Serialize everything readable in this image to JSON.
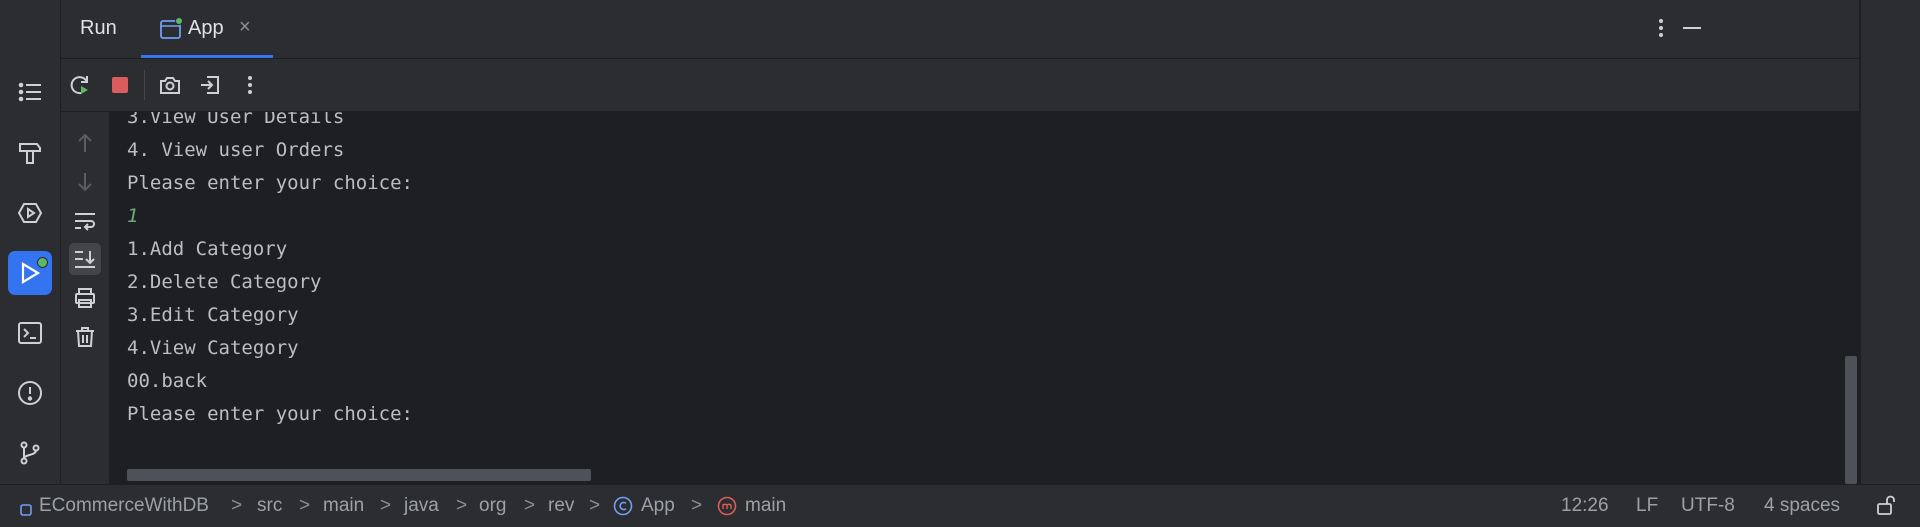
{
  "tool_window": {
    "title": "Run",
    "tab_label": "App",
    "tab_close": "×"
  },
  "icons": {
    "stripe": [
      "structure-icon",
      "build-icon",
      "services-icon",
      "run-icon",
      "terminal-icon",
      "problems-icon",
      "git-icon"
    ],
    "toolbar": [
      "rerun-icon",
      "stop-icon",
      "screenshot-icon",
      "exit-icon",
      "more-icon"
    ],
    "gutter": [
      "up-arrow-icon",
      "down-arrow-icon",
      "soft-wrap-icon",
      "scroll-to-end-icon",
      "print-icon",
      "clear-icon"
    ]
  },
  "console": {
    "lines": [
      {
        "text": "3.View User Details",
        "kind": "output"
      },
      {
        "text": "4. View user Orders",
        "kind": "output"
      },
      {
        "text": "Please enter your choice:",
        "kind": "output"
      },
      {
        "text": "1",
        "kind": "input"
      },
      {
        "text": "1.Add Category",
        "kind": "output"
      },
      {
        "text": "2.Delete Category",
        "kind": "output"
      },
      {
        "text": "3.Edit Category",
        "kind": "output"
      },
      {
        "text": "4.View Category",
        "kind": "output"
      },
      {
        "text": "00.back",
        "kind": "output"
      },
      {
        "text": "Please enter your choice:",
        "kind": "output"
      }
    ]
  },
  "statusbar": {
    "breadcrumbs": [
      "ECommerceWithDB",
      "src",
      "main",
      "java",
      "org",
      "rev",
      "App",
      "main"
    ],
    "separator": ">",
    "position": "12:26",
    "line_ending": "LF",
    "encoding": "UTF-8",
    "indent": "4 spaces"
  },
  "colors": {
    "accent": "#3574f0",
    "running_dot": "#5fb865",
    "stop": "#db5c5c",
    "input_text": "#6aab73"
  }
}
